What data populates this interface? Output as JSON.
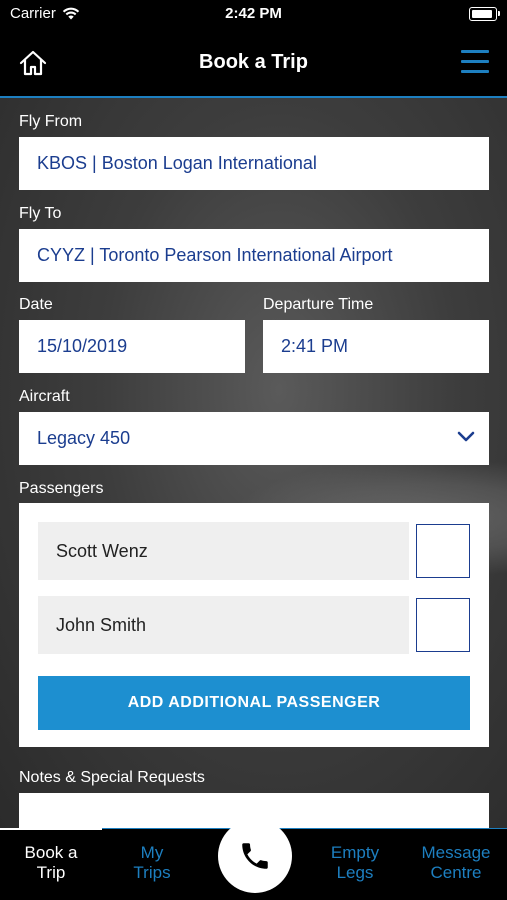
{
  "status_bar": {
    "carrier": "Carrier",
    "time": "2:42 PM",
    "battery_level": 0.85
  },
  "header": {
    "title": "Book a Trip",
    "home_icon": "home-icon",
    "menu_icon": "hamburger-menu-icon",
    "accent_color": "#1d7fc0"
  },
  "form": {
    "fly_from": {
      "label": "Fly From",
      "value": "KBOS | Boston Logan International"
    },
    "fly_to": {
      "label": "Fly To",
      "value": "CYYZ | Toronto Pearson International Airport"
    },
    "date": {
      "label": "Date",
      "value": "15/10/2019"
    },
    "departure_time": {
      "label": "Departure Time",
      "value": "2:41 PM"
    },
    "aircraft": {
      "label": "Aircraft",
      "value": "Legacy 450"
    },
    "passengers": {
      "label": "Passengers",
      "list": [
        {
          "name": "Scott Wenz",
          "checked": false
        },
        {
          "name": "John Smith",
          "checked": false
        }
      ],
      "add_button": "ADD ADDITIONAL PASSENGER"
    },
    "notes": {
      "label": "Notes & Special Requests",
      "value": ""
    }
  },
  "tabbar": {
    "tabs": [
      {
        "label_line1": "Book a",
        "label_line2": "Trip",
        "active": true
      },
      {
        "label_line1": "My",
        "label_line2": "Trips",
        "active": false
      },
      {
        "label_line1": "Empty",
        "label_line2": "Legs",
        "active": false
      },
      {
        "label_line1": "Message",
        "label_line2": "Centre",
        "active": false
      }
    ],
    "call_icon": "phone-icon"
  }
}
